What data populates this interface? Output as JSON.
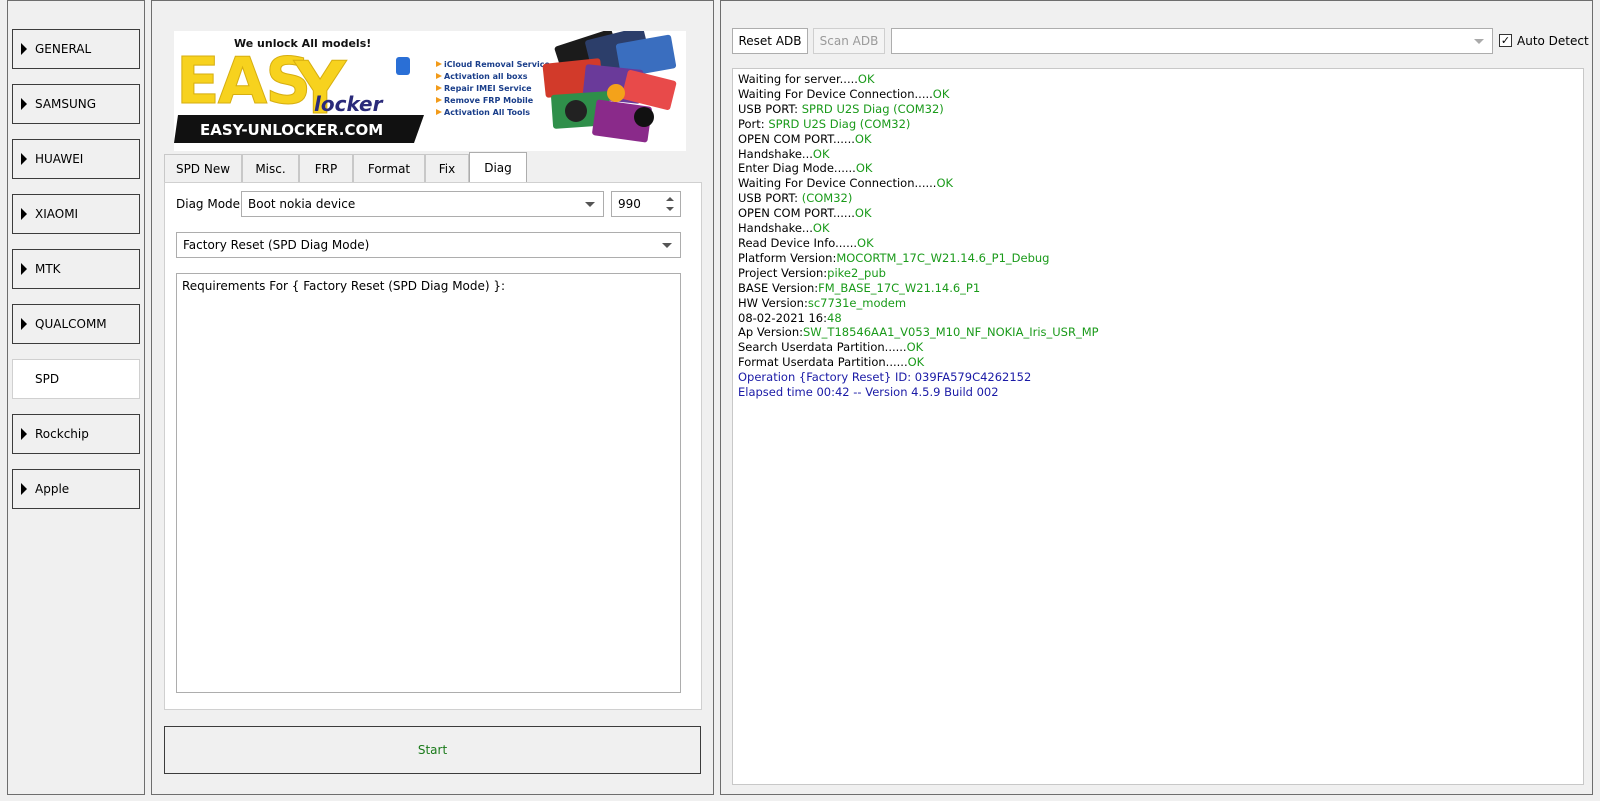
{
  "sidebar": {
    "items": [
      {
        "label": "GENERAL"
      },
      {
        "label": "SAMSUNG"
      },
      {
        "label": "HUAWEI"
      },
      {
        "label": "XIAOMI"
      },
      {
        "label": "MTK"
      },
      {
        "label": "QUALCOMM"
      },
      {
        "label": "SPD",
        "active": true
      },
      {
        "label": "Rockchip"
      },
      {
        "label": "Apple"
      }
    ]
  },
  "banner": {
    "tagline": "We unlock All models!",
    "logo_text": "EASY",
    "logo_sub": "locker",
    "url_text": "EASY-UNLOCKER.COM",
    "features": [
      "iCloud Removal Service",
      "Activation all boxs",
      "Repair IMEI Service",
      "Remove FRP Mobile",
      "Activation All Tools"
    ]
  },
  "tabs": [
    {
      "label": "SPD New"
    },
    {
      "label": "Misc."
    },
    {
      "label": "FRP"
    },
    {
      "label": "Format"
    },
    {
      "label": "Fix"
    },
    {
      "label": "Diag",
      "active": true
    }
  ],
  "diag": {
    "mode_label": "Diag Mode",
    "mode_value": "Boot nokia device",
    "spin_value": "990",
    "operation_value": "Factory Reset (SPD Diag Mode)",
    "requirements_text": "Requirements For { Factory Reset (SPD Diag Mode) }:"
  },
  "start_button": {
    "label": "Start"
  },
  "toolbar": {
    "reset_adb": "Reset ADB",
    "scan_adb": "Scan ADB",
    "port_value": "",
    "auto_detect_label": "Auto Detect",
    "auto_detect_checked": true
  },
  "log": [
    {
      "text": "Waiting for server.....",
      "status": "OK"
    },
    {
      "text": "Waiting For Device Connection.....",
      "status": "OK"
    },
    {
      "text": "USB PORT: ",
      "status": "SPRD U2S Diag (COM32)"
    },
    {
      "text": "Port: ",
      "status": "SPRD U2S Diag (COM32)"
    },
    {
      "text": "OPEN COM PORT......",
      "status": "OK"
    },
    {
      "text": "Handshake...",
      "status": "OK"
    },
    {
      "text": "Enter Diag Mode......",
      "status": "OK"
    },
    {
      "text": "Waiting For Device Connection......",
      "status": "OK"
    },
    {
      "text": "USB PORT: ",
      "status": "(COM32)"
    },
    {
      "text": "OPEN COM PORT......",
      "status": "OK"
    },
    {
      "text": "Handshake...",
      "status": "OK"
    },
    {
      "text": "Read Device Info......",
      "status": "OK"
    },
    {
      "text": "Platform Version:",
      "status": "MOCORTM_17C_W21.14.6_P1_Debug"
    },
    {
      "text": "Project Version:",
      "status": "pike2_pub"
    },
    {
      "text": "BASE Version:",
      "status": "FM_BASE_17C_W21.14.6_P1"
    },
    {
      "text": "HW Version:",
      "status": "sc7731e_modem"
    },
    {
      "text": "08-02-2021 16:",
      "status": "48"
    },
    {
      "text": "Ap Version:",
      "status": "SW_T18546AA1_V053_M10_NF_NOKIA_Iris_USR_MP"
    },
    {
      "text": "Search Userdata Partition......",
      "status": "OK"
    },
    {
      "text": "Format Userdata Partition......",
      "status": "OK"
    },
    {
      "text": "",
      "status": "",
      "blue": "Operation {Factory Reset} ID: 039FA579C4262152"
    },
    {
      "text": "",
      "status": "",
      "blue": "Elapsed time 00:42 -- Version 4.5.9 Build 002"
    }
  ],
  "colors": {
    "ok_green": "#1a9a1a",
    "info_blue": "#1a1aa6",
    "logo_yellow": "#f7d21e"
  }
}
